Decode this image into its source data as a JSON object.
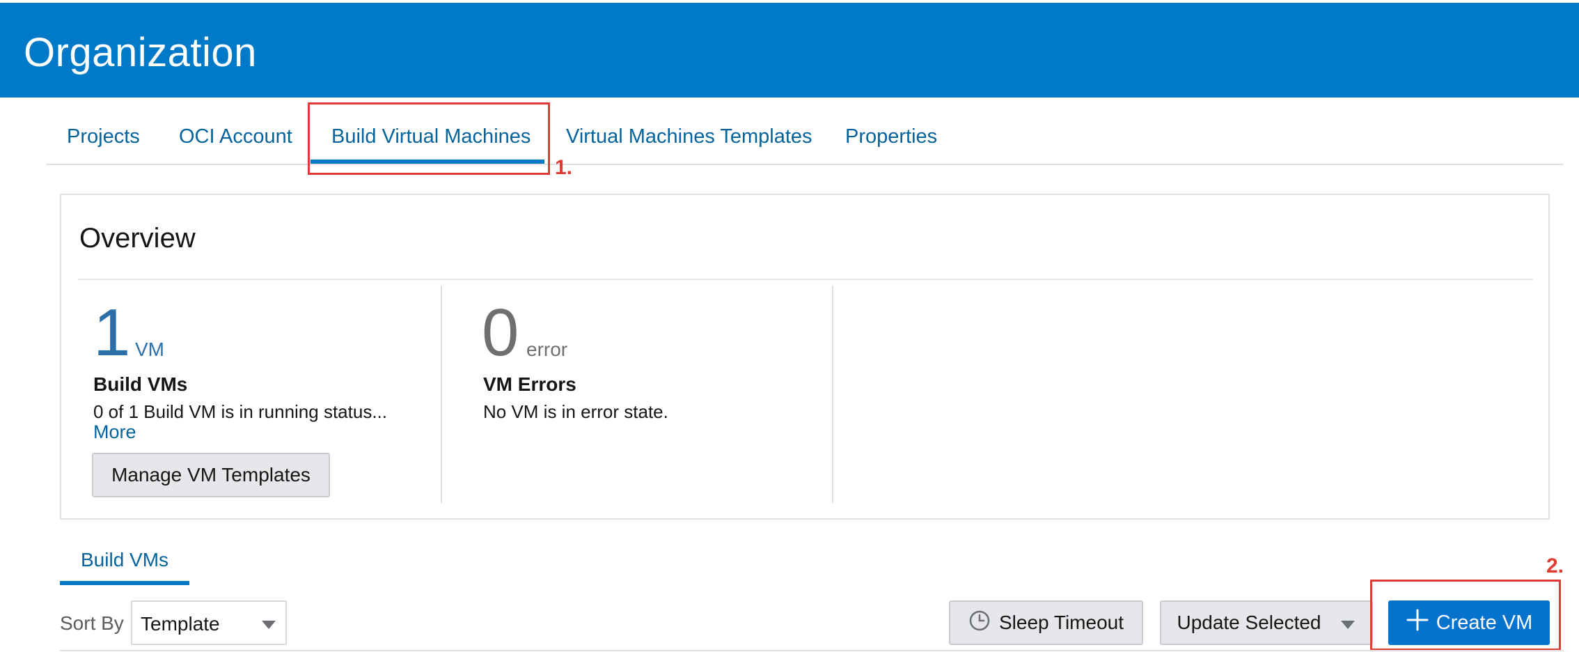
{
  "header": {
    "title": "Organization"
  },
  "tabs": [
    {
      "label": "Projects"
    },
    {
      "label": "OCI Account"
    },
    {
      "label": "Build Virtual Machines"
    },
    {
      "label": "Virtual Machines Templates"
    },
    {
      "label": "Properties"
    }
  ],
  "active_tab": "Build Virtual Machines",
  "callouts": {
    "first": "1.",
    "second": "2."
  },
  "overview": {
    "title": "Overview",
    "build_vms": {
      "count": "1",
      "unit": "VM",
      "label": "Build VMs",
      "description": "0 of 1 Build VM is in running status...",
      "more_link": "More",
      "manage_button": "Manage VM Templates"
    },
    "vm_errors": {
      "count": "0",
      "unit": "error",
      "label": "VM Errors",
      "description": "No VM is in error state."
    }
  },
  "subtabs": [
    {
      "label": "Build VMs"
    }
  ],
  "toolbar": {
    "sort_by_label": "Sort By",
    "sort_by_value": "Template",
    "sleep_timeout_button": "Sleep Timeout",
    "update_selected_button": "Update Selected",
    "create_vm_button": "Create VM"
  },
  "icons": {
    "sleep_timeout": "clock-icon",
    "create_vm": "plus-icon",
    "dropdown": "chevron-down-icon"
  },
  "colors": {
    "header_bg": "#0179c9",
    "accent_link": "#04639c",
    "primary_button": "#0572ce",
    "callout_red": "#e03c36",
    "metric_blue": "#2a6fa8",
    "metric_gray": "#6f6f6f"
  }
}
